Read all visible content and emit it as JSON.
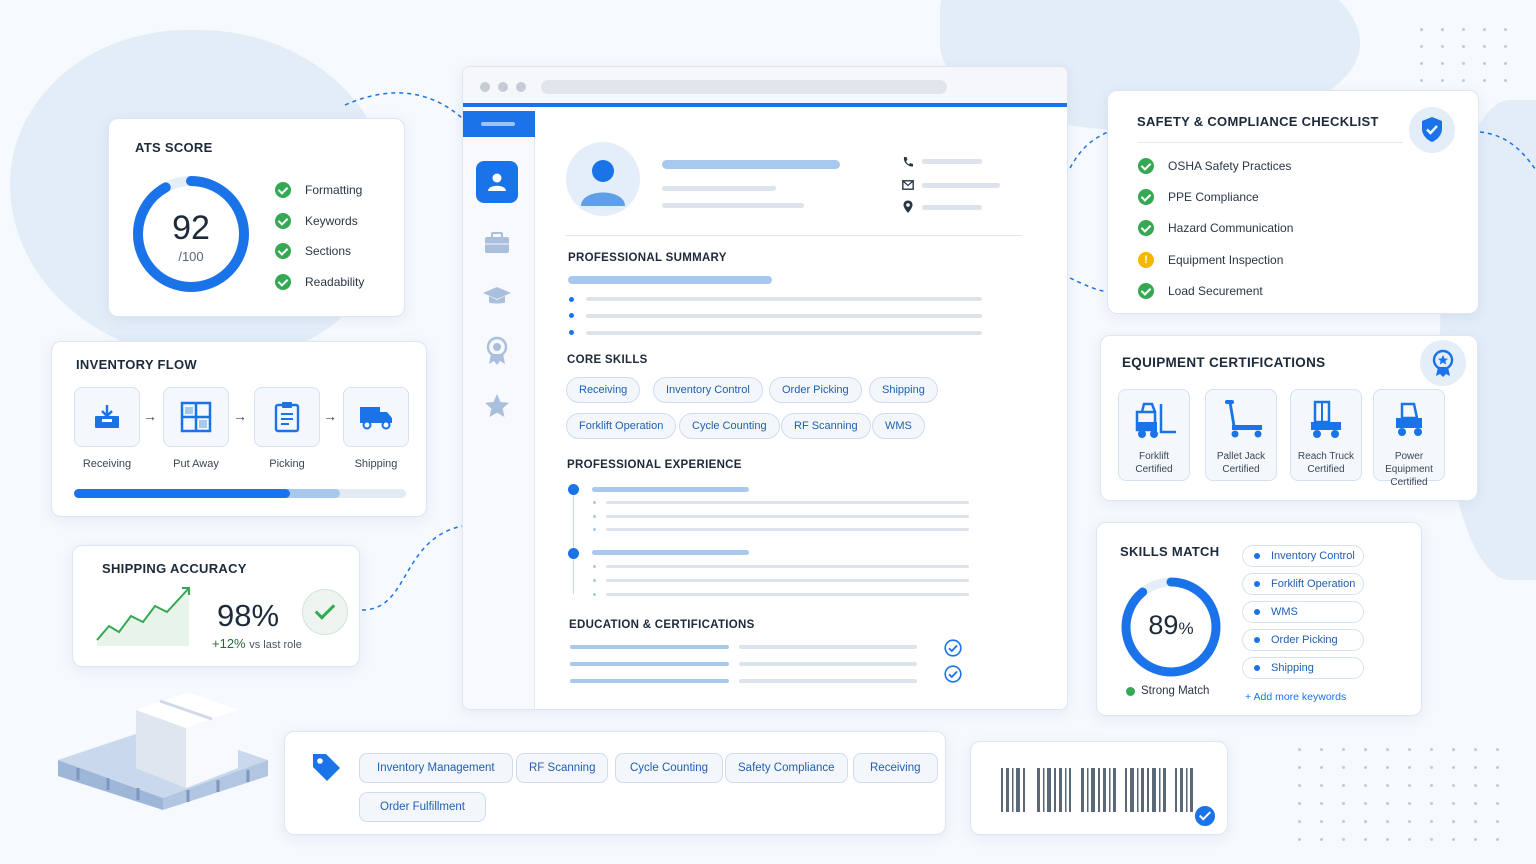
{
  "ats": {
    "title": "ATS SCORE",
    "score": "92",
    "max": "/100",
    "ring_percent": 92,
    "items": [
      "Formatting",
      "Keywords",
      "Sections",
      "Readability"
    ]
  },
  "inventory": {
    "title": "INVENTORY FLOW",
    "steps": [
      "Receiving",
      "Put Away",
      "Picking",
      "Shipping"
    ],
    "progress_percent": 65
  },
  "shipping": {
    "title": "SHIPPING ACCURACY",
    "value": "98%",
    "delta": "+12%",
    "delta_note": "vs last role"
  },
  "resume": {
    "summary_title": "PROFESSIONAL SUMMARY",
    "skills_title": "CORE SKILLS",
    "skills": [
      "Receiving",
      "Inventory Control",
      "Order Picking",
      "Shipping",
      "Forklift Operation",
      "Cycle Counting",
      "RF Scanning",
      "WMS"
    ],
    "experience_title": "PROFESSIONAL EXPERIENCE",
    "education_title": "EDUCATION & CERTIFICATIONS"
  },
  "safety": {
    "title": "SAFETY & COMPLIANCE CHECKLIST",
    "items": [
      {
        "label": "OSHA Safety Practices",
        "status": "ok"
      },
      {
        "label": "PPE Compliance",
        "status": "ok"
      },
      {
        "label": "Hazard Communication",
        "status": "ok"
      },
      {
        "label": "Equipment Inspection",
        "status": "warn"
      },
      {
        "label": "Load Securement",
        "status": "ok"
      }
    ]
  },
  "equipment": {
    "title": "EQUIPMENT CERTIFICATIONS",
    "certs": [
      {
        "line1": "Forklift",
        "line2": "Certified"
      },
      {
        "line1": "Pallet Jack",
        "line2": "Certified"
      },
      {
        "line1": "Reach Truck",
        "line2": "Certified"
      },
      {
        "line1": "Power Equipment",
        "line2": "Certified"
      }
    ]
  },
  "skills_match": {
    "title": "SKILLS MATCH",
    "value": "89",
    "unit": "%",
    "ring_percent": 89,
    "status": "Strong Match",
    "keywords": [
      "Inventory Control",
      "Forklift Operation",
      "WMS",
      "Order Picking",
      "Shipping"
    ],
    "add_link": "+ Add more keywords"
  },
  "keywords": {
    "tags": [
      "Inventory Management",
      "RF Scanning",
      "Cycle Counting",
      "Safety Compliance",
      "Receiving",
      "Order Fulfillment"
    ]
  },
  "colors": {
    "accent": "#1a73e8",
    "success": "#34a853",
    "warning": "#f5b800"
  },
  "icons": [
    "tag-icon",
    "barcode-icon",
    "shield-check-icon",
    "award-badge-icon",
    "user-icon",
    "briefcase-icon",
    "graduation-cap-icon",
    "certificate-icon",
    "star-icon",
    "phone-icon",
    "mail-icon",
    "location-icon"
  ]
}
